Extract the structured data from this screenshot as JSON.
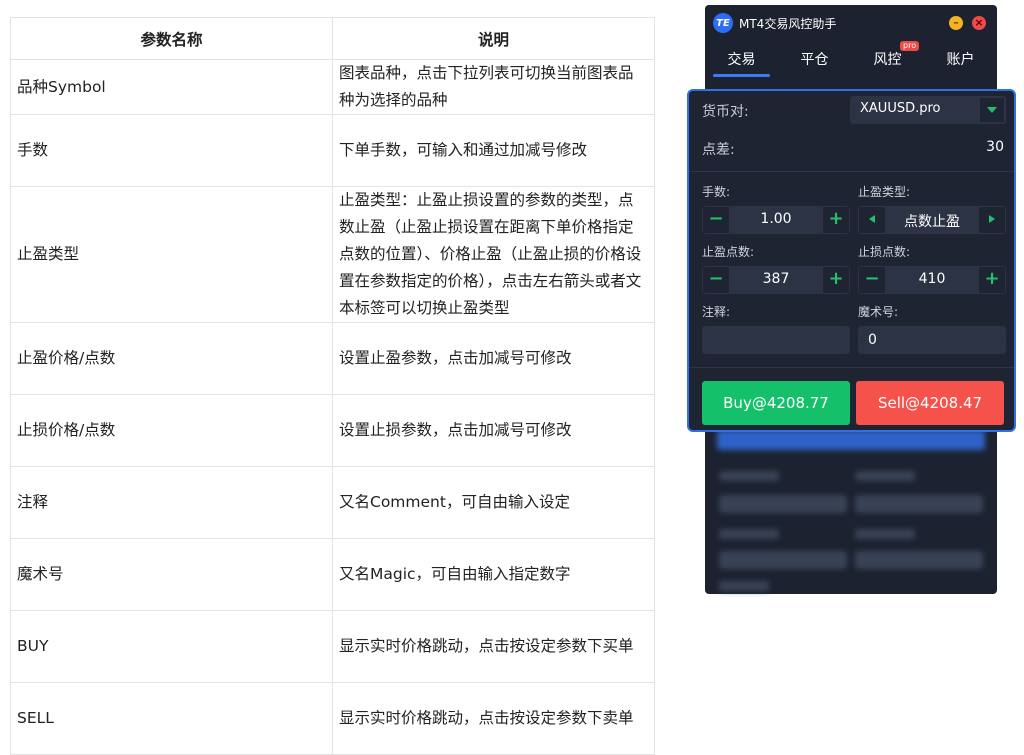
{
  "doc_table": {
    "headers": [
      "参数名称",
      "说明"
    ],
    "rows": [
      {
        "name": "品种Symbol",
        "desc": "图表品种，点击下拉列表可切换当前图表品种为选择的品种"
      },
      {
        "name": "手数",
        "desc": "下单手数，可输入和通过加减号修改"
      },
      {
        "name": "止盈类型",
        "desc": "止盈类型：止盈止损设置的参数的类型，点数止盈（止盈止损设置在距离下单价格指定点数的位置）、价格止盈（止盈止损的价格设置在参数指定的价格），点击左右箭头或者文本标签可以切换止盈类型"
      },
      {
        "name": "止盈价格/点数",
        "desc": "设置止盈参数，点击加减号可修改"
      },
      {
        "name": "止损价格/点数",
        "desc": "设置止损参数，点击加减号可修改"
      },
      {
        "name": "注释",
        "desc": "又名Comment，可自由输入设定"
      },
      {
        "name": "魔术号",
        "desc": "又名Magic，可自由输入指定数字"
      },
      {
        "name": "BUY",
        "desc": "显示实时价格跳动，点击按设定参数下买单"
      },
      {
        "name": "SELL",
        "desc": "显示实时价格跳动，点击按设定参数下卖单"
      }
    ]
  },
  "app": {
    "logo_text": "TE",
    "title": "MT4交易风控助手",
    "minimize": "–",
    "close": "×",
    "tabs": [
      "交易",
      "平仓",
      "风控",
      "账户"
    ],
    "pro_badge": "pro",
    "accent": "#2f6fe8"
  },
  "panel": {
    "pair_label": "货币对:",
    "pair_value": "XAUUSD.pro",
    "spread_label": "点差:",
    "spread_value": "30",
    "lots_label": "手数:",
    "lots_value": "1.00",
    "tp_type_label": "止盈类型:",
    "tp_type_value": "点数止盈",
    "tp_points_label": "止盈点数:",
    "tp_points_value": "387",
    "sl_points_label": "止损点数:",
    "sl_points_value": "410",
    "comment_label": "注释:",
    "comment_value": "",
    "magic_label": "魔术号:",
    "magic_value": "0",
    "minus": "−",
    "plus": "+",
    "buy_label": "Buy@4208.77",
    "sell_label": "Sell@4208.47",
    "buy_color": "#14c06a",
    "sell_color": "#f5524b"
  }
}
